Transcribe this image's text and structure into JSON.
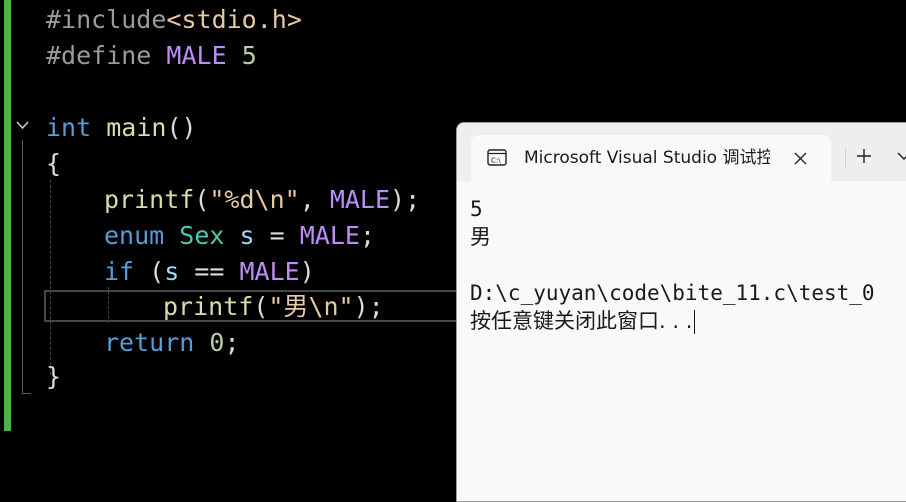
{
  "editor": {
    "lines": [
      {
        "tokens": [
          "#include",
          "<stdio.h>"
        ]
      },
      {
        "tokens": [
          "#define",
          " ",
          "MALE",
          " ",
          "5"
        ]
      },
      {
        "tokens": []
      },
      {
        "tokens": [
          "int",
          " ",
          "main",
          "()"
        ]
      },
      {
        "tokens": [
          "{"
        ]
      },
      {
        "tokens": [
          "printf",
          "(",
          "\"%d",
          "\\n",
          "\"",
          ", ",
          "MALE",
          ");"
        ]
      },
      {
        "tokens": [
          "enum",
          " ",
          "Sex",
          " ",
          "s",
          " = ",
          "MALE",
          ";"
        ]
      },
      {
        "tokens": [
          "if",
          " (",
          "s",
          " == ",
          "MALE",
          ")"
        ]
      },
      {
        "tokens": [
          "printf",
          "(",
          "\"男",
          "\\n",
          "\"",
          ");"
        ]
      },
      {
        "tokens": [
          "return",
          " ",
          "0",
          ";"
        ]
      },
      {
        "tokens": [
          "}"
        ]
      }
    ]
  },
  "console": {
    "tab_title": "Microsoft Visual Studio 调试控制台",
    "tab_icon": "console-app-icon",
    "close_icon": "close-icon",
    "new_tab_icon": "plus-icon",
    "dropdown_icon": "chevron-down-icon",
    "output": [
      "5",
      "男",
      "",
      "D:\\c_yuyan\\code\\bite_11.c\\test_0",
      "按任意键关闭此窗口. . ."
    ]
  },
  "colors": {
    "editor_bg": "#000000",
    "change_bar": "#4fb04a",
    "keyword": "#569cd6",
    "function": "#dcdcaa",
    "macro": "#bd8df6",
    "string": "#e8c9a0",
    "type": "#4ec9b0",
    "variable": "#9cdcfe",
    "number": "#b5cea8",
    "console_bg": "#f9f9f9"
  }
}
